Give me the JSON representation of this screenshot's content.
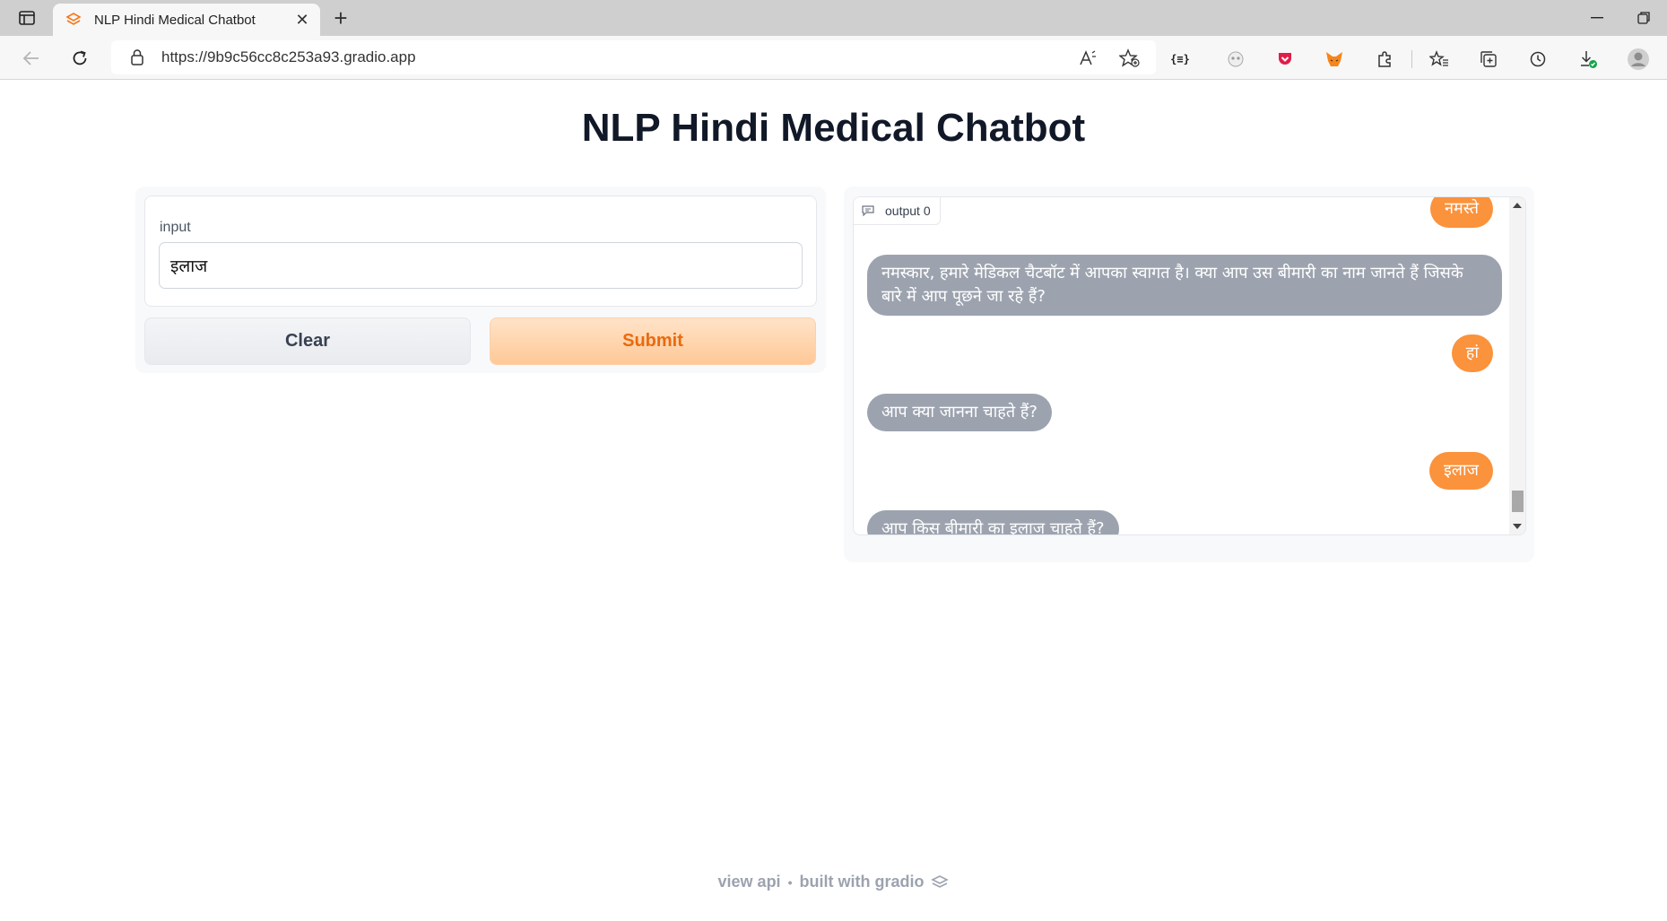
{
  "browser": {
    "tab_title": "NLP Hindi Medical Chatbot",
    "url": "https://9b9c56cc8c253a93.gradio.app"
  },
  "page": {
    "title": "NLP Hindi Medical Chatbot"
  },
  "input": {
    "label": "input",
    "value": "इलाज"
  },
  "buttons": {
    "clear": "Clear",
    "submit": "Submit"
  },
  "chat": {
    "label": "output 0",
    "messages": [
      {
        "role": "user",
        "text": "नमस्ते"
      },
      {
        "role": "bot",
        "text": "नमस्कार, हमारे मेडिकल चैटबॉट में आपका स्वागत है। क्या आप उस बीमारी का नाम जानते हैं जिसके बारे में आप पूछने जा रहे हैं?"
      },
      {
        "role": "user",
        "text": "हां"
      },
      {
        "role": "bot",
        "text": "आप क्या जानना चाहते हैं?"
      },
      {
        "role": "user",
        "text": "इलाज"
      },
      {
        "role": "bot",
        "text": "आप किस बीमारी का इलाज चाहते हैं?"
      }
    ]
  },
  "footer": {
    "view_api": "view api",
    "separator": "•",
    "built_with": "built with gradio"
  },
  "colors": {
    "user_bubble": "#fb923c",
    "bot_bubble": "#9ca3af",
    "submit_text": "#ea6a0c"
  }
}
